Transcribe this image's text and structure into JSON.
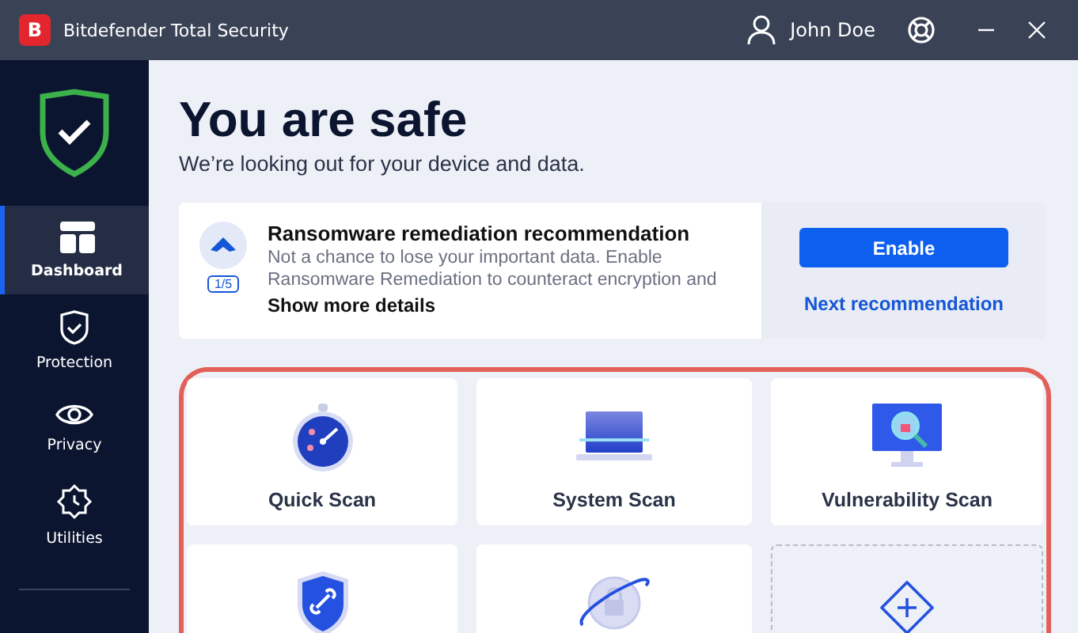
{
  "window": {
    "title": "Bitdefender Total Security",
    "logo": "B",
    "user": "John Doe"
  },
  "sidebar": {
    "items": [
      {
        "label": "Dashboard",
        "kind": "dashboard",
        "selected": true
      },
      {
        "label": "Protection",
        "kind": "protection",
        "selected": false
      },
      {
        "label": "Privacy",
        "kind": "privacy",
        "selected": false
      },
      {
        "label": "Utilities",
        "kind": "utilities",
        "selected": false
      }
    ]
  },
  "status": {
    "title": "You are safe",
    "subtitle": "We’re looking out for your device and data."
  },
  "recommendation": {
    "title": "Ransomware remediation recommendation",
    "text": "Not a chance to lose your important data. Enable Ransomware Remediation to counteract encryption and",
    "counter": "1/5",
    "details": "Show more details",
    "enable": "Enable",
    "next": "Next recommendation"
  },
  "actions": [
    {
      "kind": "quick",
      "label": "Quick Scan"
    },
    {
      "kind": "system",
      "label": "System Scan"
    },
    {
      "kind": "vuln",
      "label": "Vulnerability Scan"
    },
    {
      "kind": "link"
    },
    {
      "kind": "vpn"
    },
    {
      "kind": "add"
    }
  ]
}
